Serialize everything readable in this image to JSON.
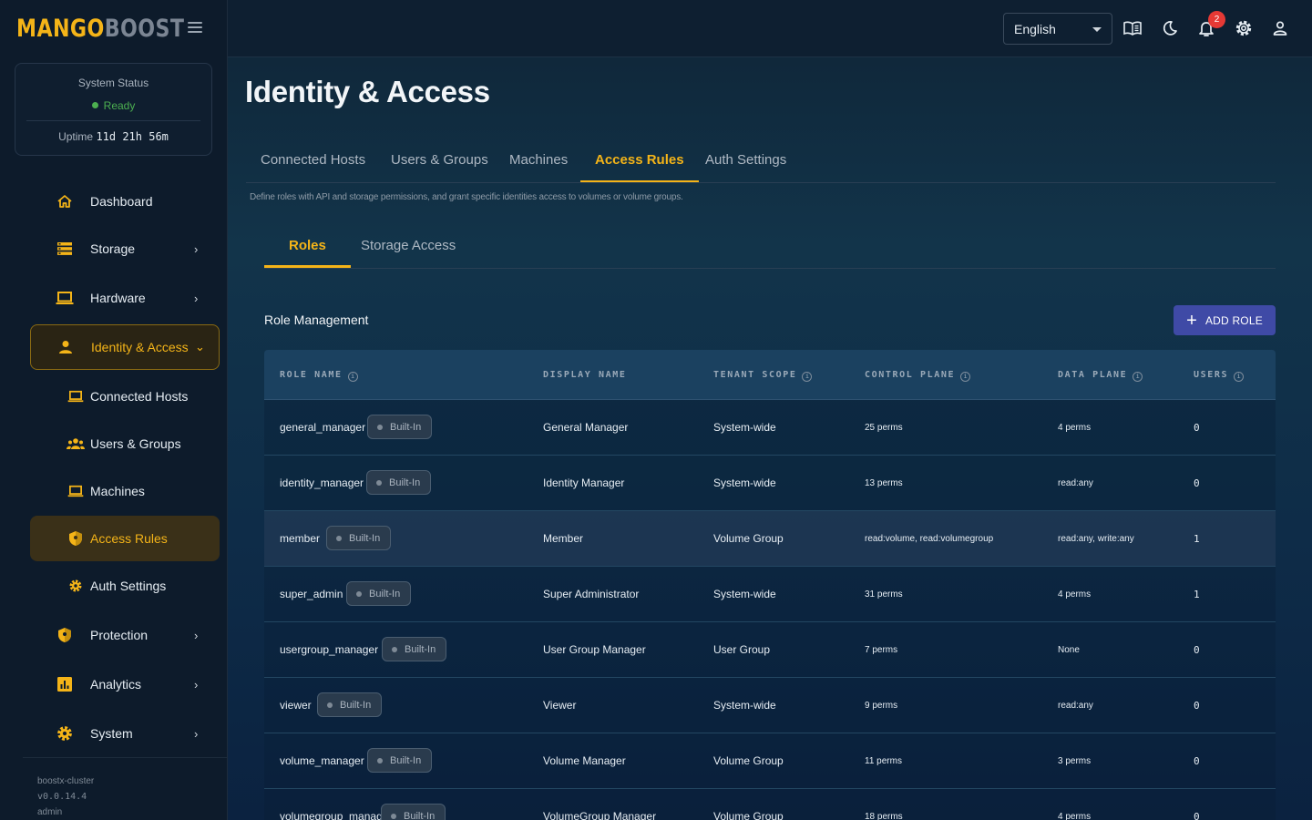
{
  "brand": {
    "name_a": "MANGO",
    "name_b": "BOOST"
  },
  "system_status": {
    "title": "System Status",
    "state": "Ready",
    "uptime_label": "Uptime",
    "uptime_value": "11d 21h 56m"
  },
  "sidebar": {
    "items": [
      {
        "label": "Dashboard"
      },
      {
        "label": "Storage"
      },
      {
        "label": "Hardware"
      },
      {
        "label": "Identity & Access"
      },
      {
        "label": "Connected Hosts"
      },
      {
        "label": "Users & Groups"
      },
      {
        "label": "Machines"
      },
      {
        "label": "Access Rules"
      },
      {
        "label": "Auth Settings"
      },
      {
        "label": "Protection"
      },
      {
        "label": "Analytics"
      },
      {
        "label": "System"
      }
    ],
    "footer": {
      "cluster": "boostx-cluster",
      "version": "v0.0.14.4",
      "user": "admin"
    }
  },
  "topbar": {
    "language": "English",
    "notification_count": "2"
  },
  "page": {
    "title": "Identity & Access",
    "tabs": [
      "Connected Hosts",
      "Users & Groups",
      "Machines",
      "Access Rules",
      "Auth Settings"
    ],
    "description": "Define roles with API and storage permissions,  and grant specific identities access to volumes or volume groups.",
    "subtabs": [
      "Roles",
      "Storage Access"
    ],
    "section_title": "Role Management",
    "add_button": "ADD ROLE"
  },
  "table": {
    "headers": [
      "ROLE NAME",
      "DISPLAY NAME",
      "TENANT SCOPE",
      "CONTROL PLANE",
      "DATA PLANE",
      "USERS"
    ],
    "builtin_label": "Built-In",
    "rows": [
      {
        "role": "general_manager",
        "display": "General Manager",
        "scope": "System-wide",
        "control": "25 perms",
        "data": "4 perms",
        "users": "0"
      },
      {
        "role": "identity_manager",
        "display": "Identity Manager",
        "scope": "System-wide",
        "control": "13 perms",
        "data": "read:any",
        "users": "0"
      },
      {
        "role": "member",
        "display": "Member",
        "scope": "Volume Group",
        "control": "read:volume,  read:volumegroup",
        "data": "read:any,  write:any",
        "users": "1"
      },
      {
        "role": "super_admin",
        "display": "Super Administrator",
        "scope": "System-wide",
        "control": "31 perms",
        "data": "4 perms",
        "users": "1"
      },
      {
        "role": "usergroup_manager",
        "display": "User Group Manager",
        "scope": "User Group",
        "control": "7 perms",
        "data": "None",
        "users": "0"
      },
      {
        "role": "viewer",
        "display": "Viewer",
        "scope": "System-wide",
        "control": "9 perms",
        "data": "read:any",
        "users": "0"
      },
      {
        "role": "volume_manager",
        "display": "Volume Manager",
        "scope": "Volume Group",
        "control": "11 perms",
        "data": "3 perms",
        "users": "0"
      },
      {
        "role": "volumegroup_manager",
        "display": "VolumeGroup Manager",
        "scope": "Volume Group",
        "control": "18 perms",
        "data": "4 perms",
        "users": "0"
      }
    ]
  },
  "colors": {
    "accent": "#f4b418",
    "primary_button": "#3f4aa6",
    "ready": "#4caf50",
    "badge": "#e53935"
  }
}
